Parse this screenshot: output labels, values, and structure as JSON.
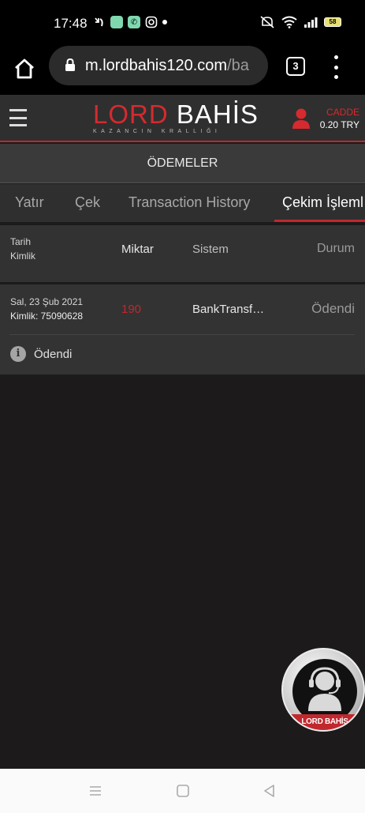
{
  "status_bar": {
    "time": "17:48",
    "battery": "58",
    "icons": [
      "missed-call-icon",
      "app-notification-icon",
      "phone-notification-icon",
      "instagram-icon",
      "notification-dot-icon",
      "mute-icon",
      "wifi-icon",
      "signal-icon",
      "battery-icon"
    ]
  },
  "browser": {
    "url_host": "m.lordbahis120.com",
    "url_path": "/ba",
    "tab_count": "3"
  },
  "site": {
    "logo_left": "LORD",
    "logo_right": "BAHİS",
    "logo_tagline": "KAZANCIN KRALLIĞI",
    "user_name": "CADDE",
    "user_balance": "0.20 TRY"
  },
  "page": {
    "title": "ÖDEMELER"
  },
  "tabs": [
    {
      "label": "Yatır",
      "active": false
    },
    {
      "label": "Çek",
      "active": false
    },
    {
      "label": "Transaction History",
      "active": false
    },
    {
      "label": "Çekim İşleml",
      "active": true
    }
  ],
  "table": {
    "headers": {
      "date": "Tarih",
      "id": "Kimlik",
      "amount": "Miktar",
      "system": "Sistem",
      "status": "Durum"
    },
    "rows": [
      {
        "date": "Sal, 23 Şub 2021",
        "id": "Kimlik: 75090628",
        "amount": "190",
        "system": "BankTransf…",
        "status": "Ödendi",
        "detail_status": "Ödendi"
      }
    ]
  },
  "support": {
    "label": "LORD BAHİS"
  },
  "colors": {
    "accent_red": "#d52a2f",
    "header_bg": "#2f2f2f",
    "page_bg": "#1c1a1a"
  }
}
